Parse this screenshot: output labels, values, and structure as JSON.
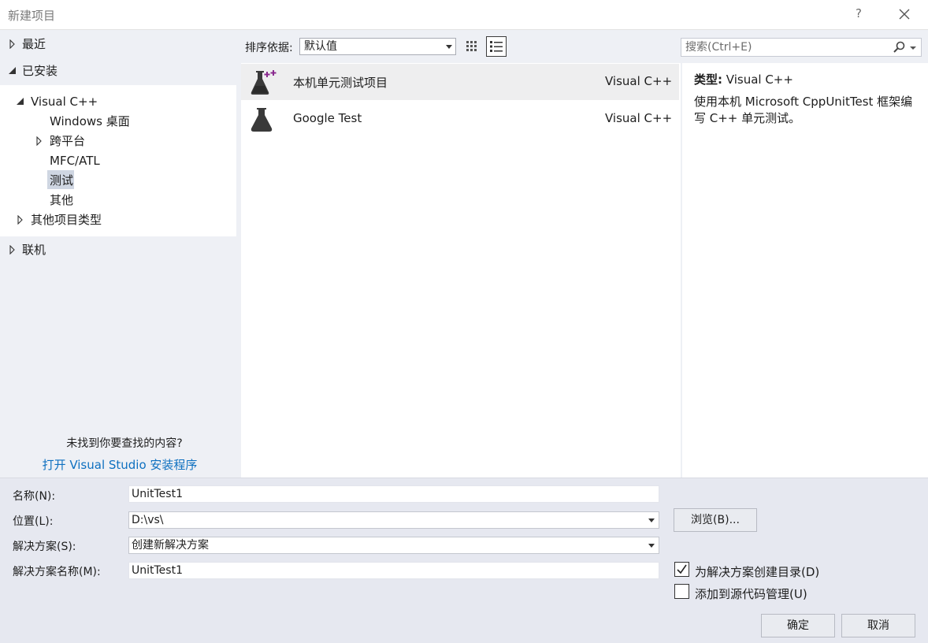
{
  "window": {
    "title": "新建项目",
    "help_label": "?"
  },
  "tree": {
    "recent": "最近",
    "installed": "已安装",
    "visual_cpp": "Visual C++",
    "windows_desktop": "Windows 桌面",
    "cross_platform": "跨平台",
    "mfc_atl": "MFC/ATL",
    "test": "测试",
    "other": "其他",
    "other_project_types": "其他项目类型",
    "online": "联机"
  },
  "not_found": {
    "question": "未找到你要查找的内容?",
    "link": "打开 Visual Studio 安装程序"
  },
  "sort": {
    "label": "排序依据:",
    "value": "默认值"
  },
  "search": {
    "placeholder": "搜索(Ctrl+E)"
  },
  "templates": [
    {
      "name": "本机单元测试项目",
      "language": "Visual C++",
      "selected": true
    },
    {
      "name": "Google Test",
      "language": "Visual C++",
      "selected": false
    }
  ],
  "details": {
    "type_label": "类型:",
    "type_value": "Visual C++",
    "description": "使用本机 Microsoft CppUnitTest 框架编写 C++ 单元测试。"
  },
  "form": {
    "name_label": "名称(N):",
    "name_value": "UnitTest1",
    "location_label": "位置(L):",
    "location_value": "D:\\vs\\",
    "browse_label": "浏览(B)...",
    "solution_label": "解决方案(S):",
    "solution_value": "创建新解决方案",
    "solution_name_label": "解决方案名称(M):",
    "solution_name_value": "UnitTest1",
    "create_dir_label": "为解决方案创建目录(D)",
    "create_dir_checked": true,
    "source_control_label": "添加到源代码管理(U)",
    "source_control_checked": false
  },
  "buttons": {
    "ok": "确定",
    "cancel": "取消"
  },
  "colors": {
    "link": "#0e70c0",
    "selected_row": "#eeeeef",
    "tree_selected": "#cfd6e2",
    "icon_plus": "#8a2a8f"
  }
}
